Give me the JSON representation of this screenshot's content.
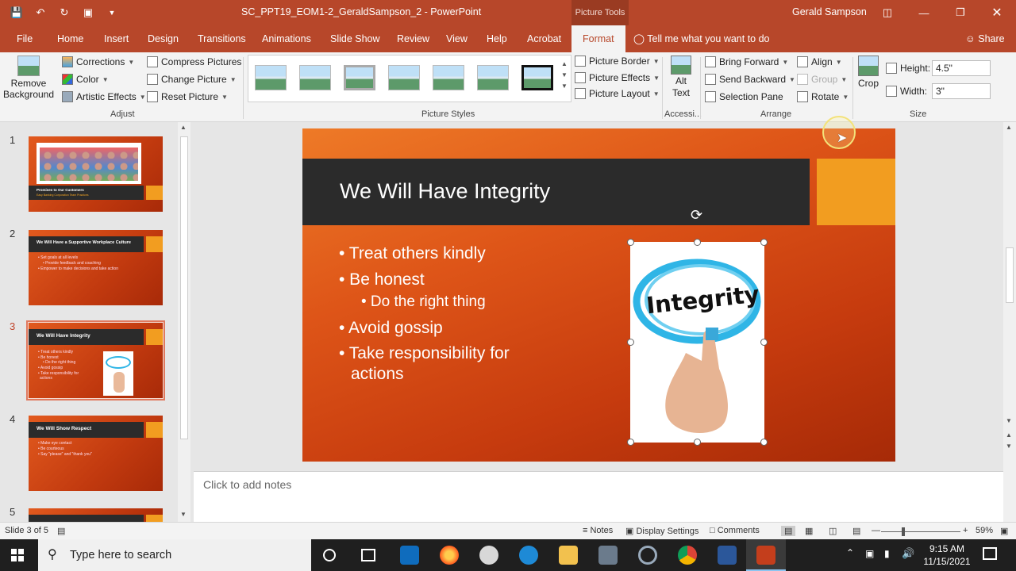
{
  "window": {
    "doc_title": "SC_PPT19_EOM1-2_GeraldSampson_2  -  PowerPoint",
    "contextual": "Picture Tools",
    "user": "Gerald Sampson"
  },
  "tabs": [
    "File",
    "Home",
    "Insert",
    "Design",
    "Transitions",
    "Animations",
    "Slide Show",
    "Review",
    "View",
    "Help",
    "Acrobat",
    "Format"
  ],
  "active_tab": "Format",
  "tell_me": "Tell me what you want to do",
  "share": "Share",
  "ribbon": {
    "remove_bg_1": "Remove",
    "remove_bg_2": "Background",
    "corrections": "Corrections",
    "color": "Color",
    "artistic": "Artistic Effects",
    "compress": "Compress Pictures",
    "change": "Change Picture",
    "reset": "Reset Picture",
    "adjust_label": "Adjust",
    "styles_label": "Picture Styles",
    "border": "Picture Border",
    "effects": "Picture Effects",
    "layout": "Picture Layout",
    "alt_1": "Alt",
    "alt_2": "Text",
    "access_label": "Accessi...",
    "bring": "Bring Forward",
    "send": "Send Backward",
    "selpane": "Selection Pane",
    "align": "Align",
    "group": "Group",
    "rotate": "Rotate",
    "arrange_label": "Arrange",
    "crop": "Crop",
    "height_label": "Height:",
    "height_value": "4.5\"",
    "width_label": "Width:",
    "width_value": "3\"",
    "size_label": "Size"
  },
  "thumbs": {
    "t1_title": "Promises to Our Customers",
    "t1_sub": "Easy Banking Corporation Team Practices",
    "t2_title": "We Will Have a Supportive Workplace Culture",
    "t2_l1": "• Set goals at all levels",
    "t2_l2": "• Provide feedback and coaching",
    "t2_l3": "• Empower to make decisions and take action",
    "t3_title": "We Will Have Integrity",
    "t3_l1": "• Treat others kindly",
    "t3_l2": "• Be honest",
    "t3_l3": "• Do the right thing",
    "t3_l4": "• Avoid gossip",
    "t3_l5": "• Take responsibility for",
    "t3_l6": "actions",
    "t4_title": "We Will Show Respect",
    "t4_l1": "• Make eye contact",
    "t4_l2": "• Be courteous",
    "t4_l3": "• Say \"please\" and \"thank you\"",
    "n1": "1",
    "n2": "2",
    "n3": "3",
    "n4": "4",
    "n5": "5"
  },
  "slide": {
    "title": "We Will Have Integrity",
    "b1": "• Treat others kindly",
    "b2": "• Be honest",
    "b3": "• Do the right thing",
    "b4": "• Take responsibility for",
    "b4b": "actions",
    "b5": "• Avoid gossip",
    "picture_word": "Integrity"
  },
  "notes_placeholder": "Click to add notes",
  "status": {
    "slide_of": "Slide 3 of 5",
    "notes": "Notes",
    "display": "Display Settings",
    "comments": "Comments",
    "zoom": "59%"
  },
  "taskbar": {
    "search": "Type here to search",
    "time": "9:15 AM",
    "date": "11/15/2021"
  },
  "colors": {
    "accent": "#b7472a",
    "slide_orange": "#de5518",
    "title_band": "#2b2b2b",
    "square": "#f29d20"
  }
}
